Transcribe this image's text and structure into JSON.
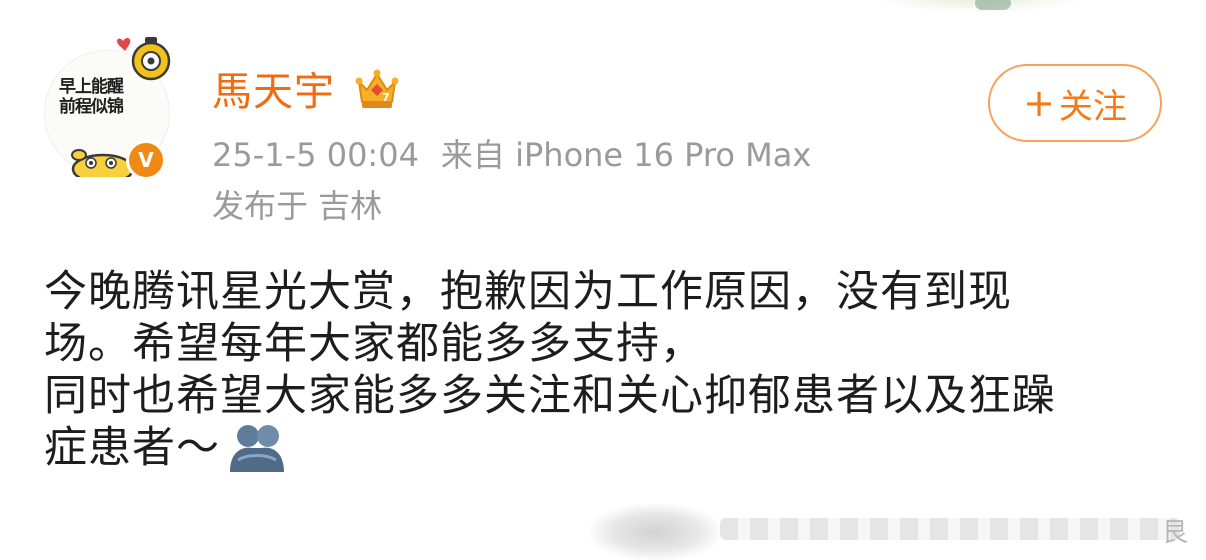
{
  "post": {
    "author": {
      "avatar_text": "早上能醒\n前程似锦",
      "name": "馬天宇",
      "verify_badge": "V",
      "crown_icon": "crown-icon"
    },
    "timestamp": "25-1-5 00:04",
    "source": "来自 iPhone 16 Pro Max",
    "location": "发布于 吉林",
    "follow_label": "关注",
    "follow_plus": "+",
    "body_lines": [
      "今晚腾讯星光大赏，抱歉因为工作原因，没有到现",
      "场。希望每年大家都能多多支持，",
      "同时也希望大家能多多关注和关心抑郁患者以及狂躁",
      "症患者～"
    ],
    "body_emoji": "hug-icon",
    "watermark_char": "艮",
    "colors": {
      "name": "#f26b10",
      "follow": "#f27a1a",
      "follow_border": "#f7a25a",
      "meta": "#9a9a9a",
      "text": "#1d1d1d",
      "badge": "#f18a14"
    }
  }
}
